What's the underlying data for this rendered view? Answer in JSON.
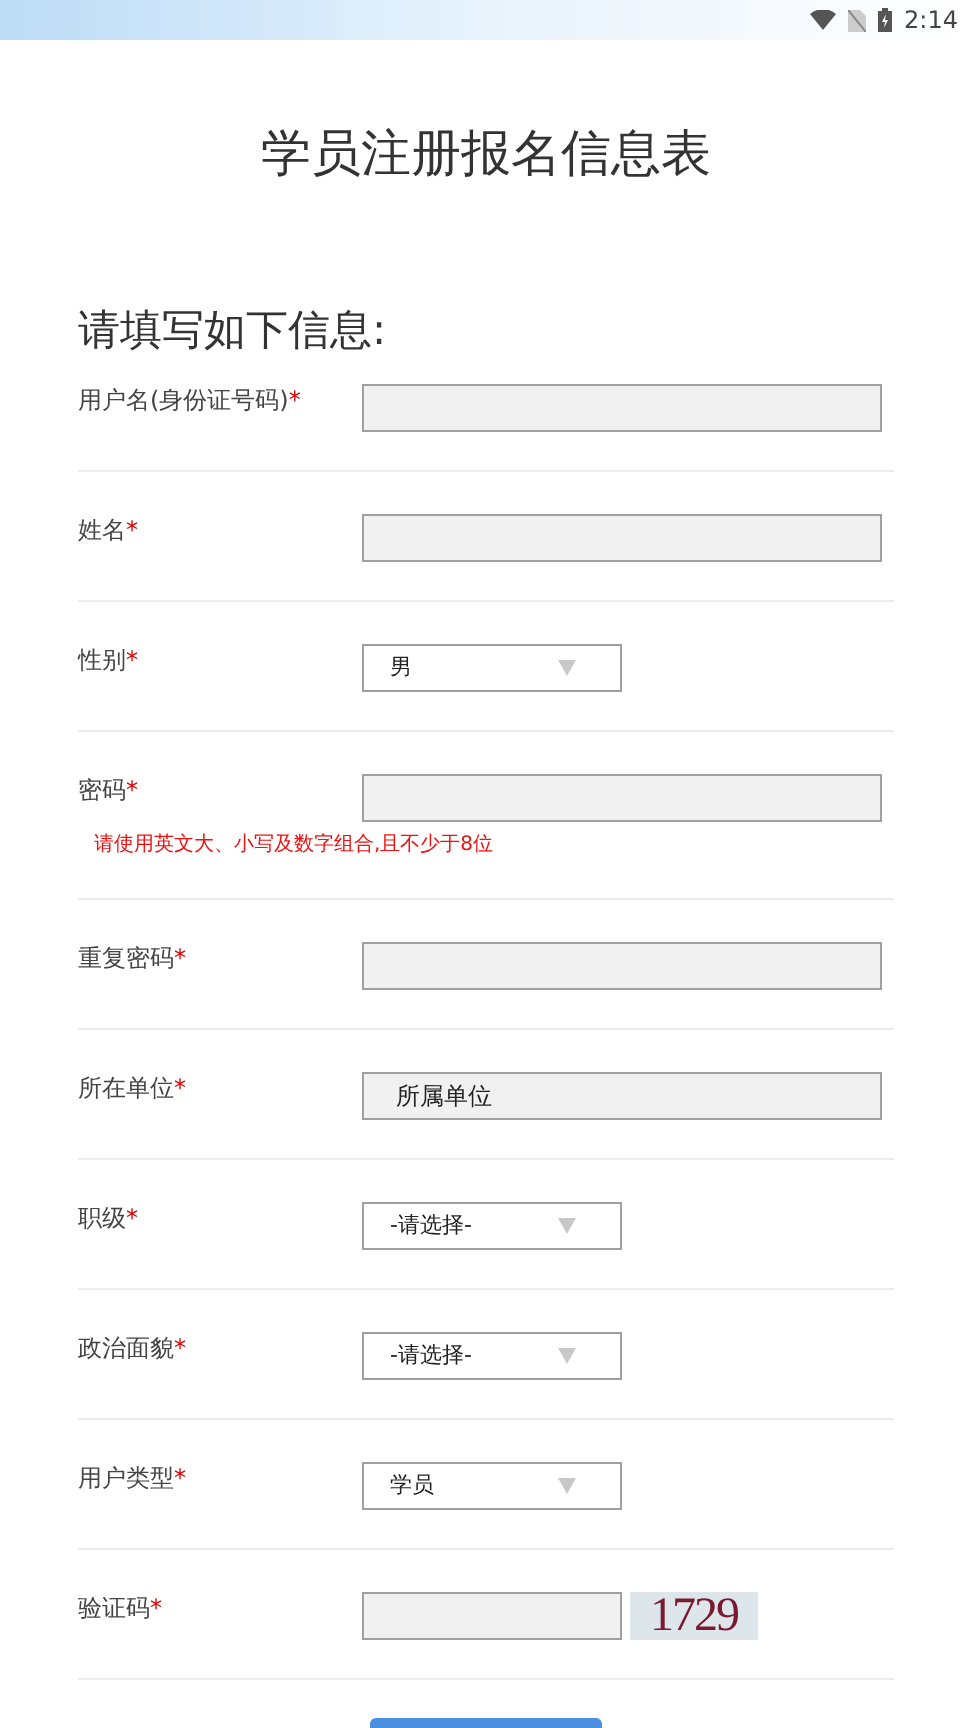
{
  "status_bar": {
    "time": "2:14"
  },
  "title": "学员注册报名信息表",
  "subtitle": "请填写如下信息:",
  "fields": [
    {
      "kind": "text",
      "label": "用户名(身份证号码)",
      "required_mark": "*"
    },
    {
      "kind": "text",
      "label": "姓名",
      "required_mark": "*"
    },
    {
      "kind": "select",
      "label": "性别",
      "required_mark": "*",
      "value": "男"
    },
    {
      "kind": "text",
      "label": "密码",
      "required_mark": "*",
      "hint": "请使用英文大、小写及数字组合,且不少于8位"
    },
    {
      "kind": "text",
      "label": "重复密码",
      "required_mark": "*"
    },
    {
      "kind": "text",
      "label": "所在单位",
      "required_mark": "*",
      "value": "所属单位"
    },
    {
      "kind": "select",
      "label": "职级",
      "required_mark": "*",
      "value": "-请选择-"
    },
    {
      "kind": "select",
      "label": "政治面貌",
      "required_mark": "*",
      "value": "-请选择-"
    },
    {
      "kind": "select",
      "label": "用户类型",
      "required_mark": "*",
      "value": "学员"
    },
    {
      "kind": "captcha",
      "label": "验证码",
      "required_mark": "*",
      "code": "1729"
    }
  ],
  "submit_button": {
    "kind": "button"
  }
}
